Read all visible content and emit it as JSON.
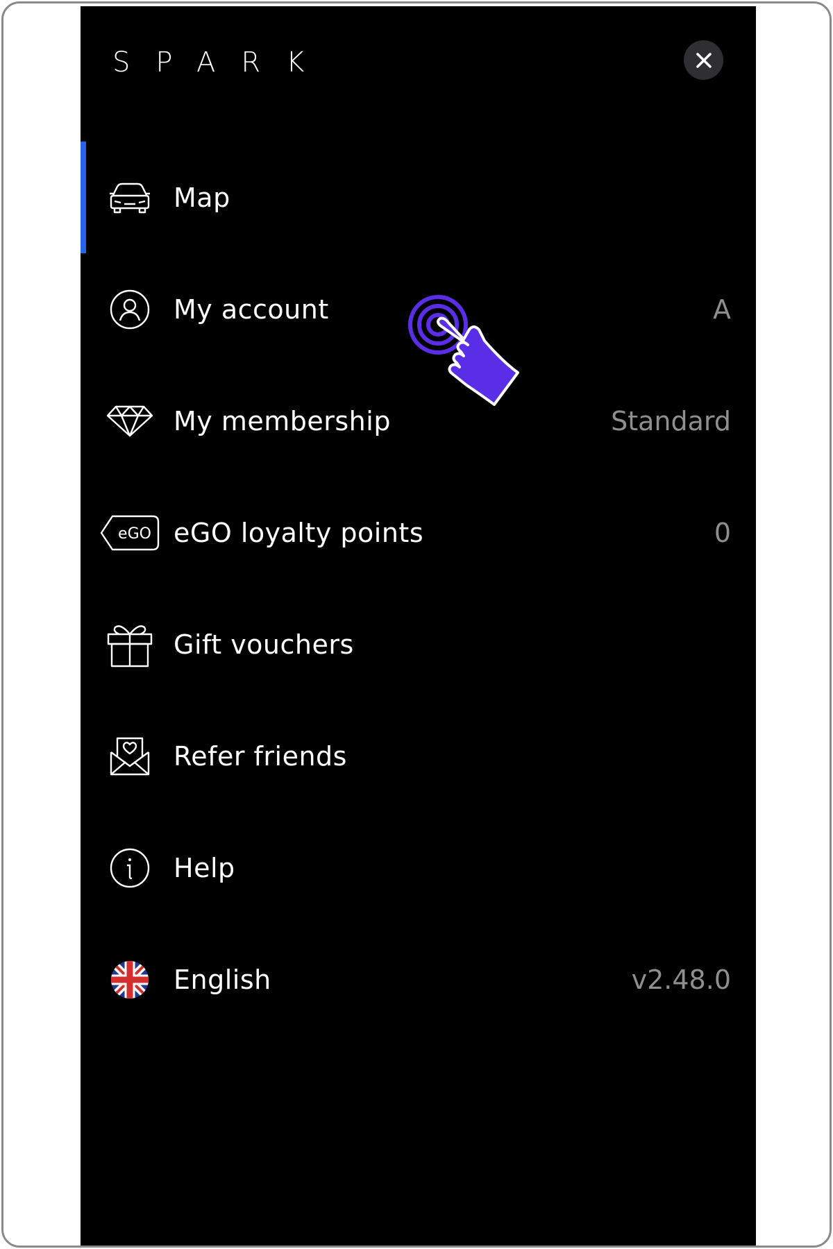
{
  "brand": {
    "name": "SPARK"
  },
  "close_icon": "close-icon",
  "colors": {
    "accent": "#2563eb",
    "background": "#000000",
    "secondary_text": "#8f8f8f",
    "tap_hint": "#5a2ee6"
  },
  "menu": {
    "items": [
      {
        "label": "Map",
        "value": "",
        "icon": "car-icon",
        "active": true
      },
      {
        "label": "My account",
        "value": "A",
        "icon": "user-icon"
      },
      {
        "label": "My membership",
        "value": "Standard",
        "icon": "diamond-icon"
      },
      {
        "label": "eGO loyalty points",
        "value": "0",
        "icon": "ego-tag-icon",
        "icon_text": "eGO"
      },
      {
        "label": "Gift vouchers",
        "value": "",
        "icon": "gift-icon"
      },
      {
        "label": "Refer friends",
        "value": "",
        "icon": "envelope-heart-icon"
      },
      {
        "label": "Help",
        "value": "",
        "icon": "info-icon"
      },
      {
        "label": "English",
        "value": "v2.48.0",
        "icon": "uk-flag-icon"
      }
    ]
  }
}
